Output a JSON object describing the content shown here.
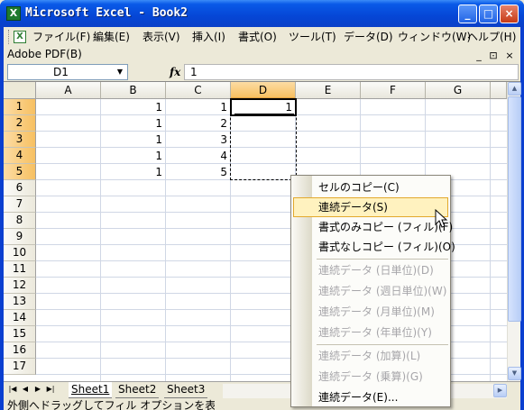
{
  "window": {
    "title": "Microsoft Excel - Book2",
    "app_icon": "X",
    "controls": [
      "_",
      "□",
      "×"
    ]
  },
  "menubar": {
    "items": [
      "ファイル(F)",
      "編集(E)",
      "表示(V)",
      "挿入(I)",
      "書式(O)",
      "ツール(T)",
      "データ(D)",
      "ウィンドウ(W)",
      "ヘルプ(H)"
    ],
    "mdi_controls": [
      "_",
      "⊡",
      "×"
    ]
  },
  "pdfbar": {
    "label": "Adobe PDF(B)"
  },
  "formula": {
    "name_box": "D1",
    "fx_label": "fx",
    "value": "1"
  },
  "columns": [
    "A",
    "B",
    "C",
    "D",
    "E",
    "F",
    "G"
  ],
  "selected_column": "D",
  "rows": [
    "1",
    "2",
    "3",
    "4",
    "5",
    "6",
    "7",
    "8",
    "9",
    "10",
    "11",
    "12",
    "13",
    "14",
    "15",
    "16",
    "17"
  ],
  "selected_rows": [
    "1",
    "2",
    "3",
    "4",
    "5"
  ],
  "cells": {
    "B1": "1",
    "B2": "1",
    "B3": "1",
    "B4": "1",
    "B5": "1",
    "C1": "1",
    "C2": "2",
    "C3": "3",
    "C4": "4",
    "C5": "5",
    "D1": "1"
  },
  "sheet_tabs": [
    "Sheet1",
    "Sheet2",
    "Sheet3"
  ],
  "active_sheet": "Sheet1",
  "tab_nav": [
    "|◀",
    "◀",
    "▶",
    "▶|"
  ],
  "statusbar": {
    "text": "外側へドラッグしてフィル オプションを表示す"
  },
  "context_menu": {
    "items": [
      {
        "label": "セルのコピー(C)",
        "state": "normal"
      },
      {
        "label": "連続データ(S)",
        "state": "hover"
      },
      {
        "label": "書式のみコピー (フィル)(F)",
        "state": "normal"
      },
      {
        "label": "書式なしコピー (フィル)(O)",
        "state": "normal"
      },
      {
        "label": "連続データ (日単位)(D)",
        "state": "disabled"
      },
      {
        "label": "連続データ (週日単位)(W)",
        "state": "disabled"
      },
      {
        "label": "連続データ (月単位)(M)",
        "state": "disabled"
      },
      {
        "label": "連続データ (年単位)(Y)",
        "state": "disabled"
      },
      {
        "label": "連続データ (加算)(L)",
        "state": "disabled"
      },
      {
        "label": "連続データ (乗算)(G)",
        "state": "disabled"
      },
      {
        "label": "連続データ(E)...",
        "state": "normal"
      }
    ]
  }
}
